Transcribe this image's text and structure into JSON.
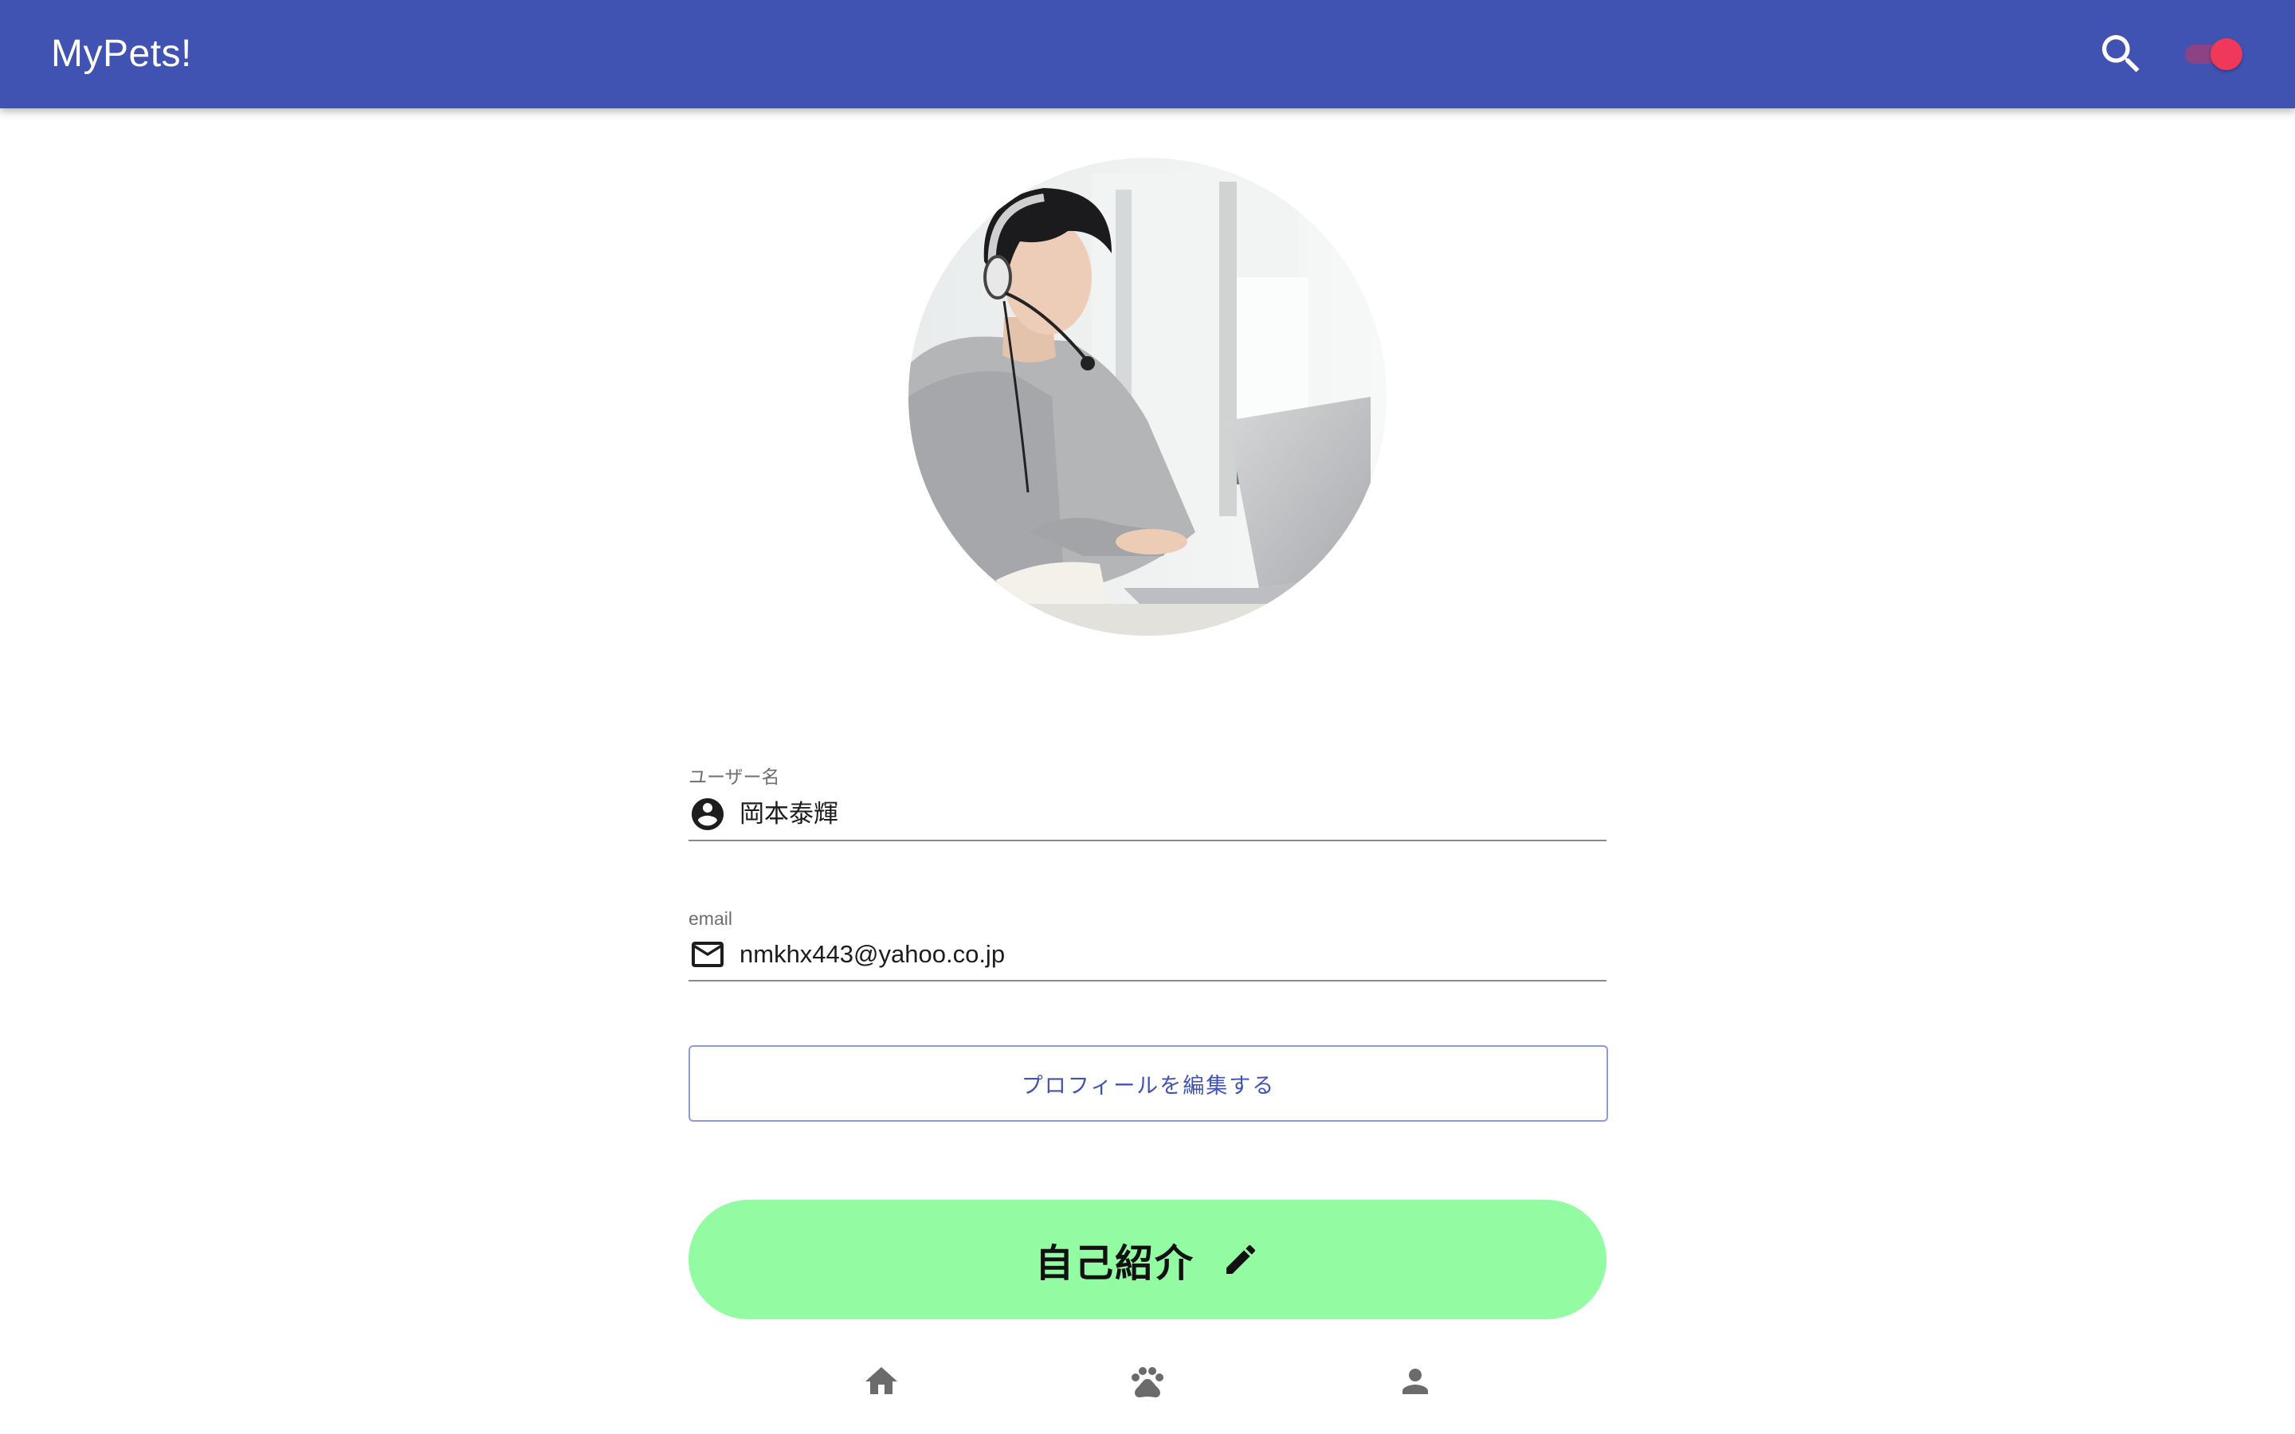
{
  "app": {
    "title": "MyPets!"
  },
  "header": {
    "search_icon": "search-icon",
    "theme_toggle": {
      "state": "on",
      "thumb_color": "#f0385a",
      "track_color": "#9b3f7a"
    }
  },
  "colors": {
    "primary": "#4153b2",
    "intro_button": "#93fca3",
    "outline_border": "#8f9ad0"
  },
  "profile": {
    "avatar_icon": "profile-photo",
    "username": {
      "label": "ユーザー名",
      "value": "岡本泰輝",
      "icon": "account-circle-icon"
    },
    "email": {
      "label": "email",
      "value": "nmkhx443@yahoo.co.jp",
      "icon": "mail-icon"
    },
    "edit_button_label": "プロフィールを編集する",
    "intro_button_label": "自己紹介",
    "intro_button_icon": "pencil-icon"
  },
  "bottom_nav": {
    "items": [
      {
        "name": "home",
        "icon": "home-icon"
      },
      {
        "name": "pets",
        "icon": "paw-icon"
      },
      {
        "name": "profile",
        "icon": "person-icon"
      }
    ]
  }
}
